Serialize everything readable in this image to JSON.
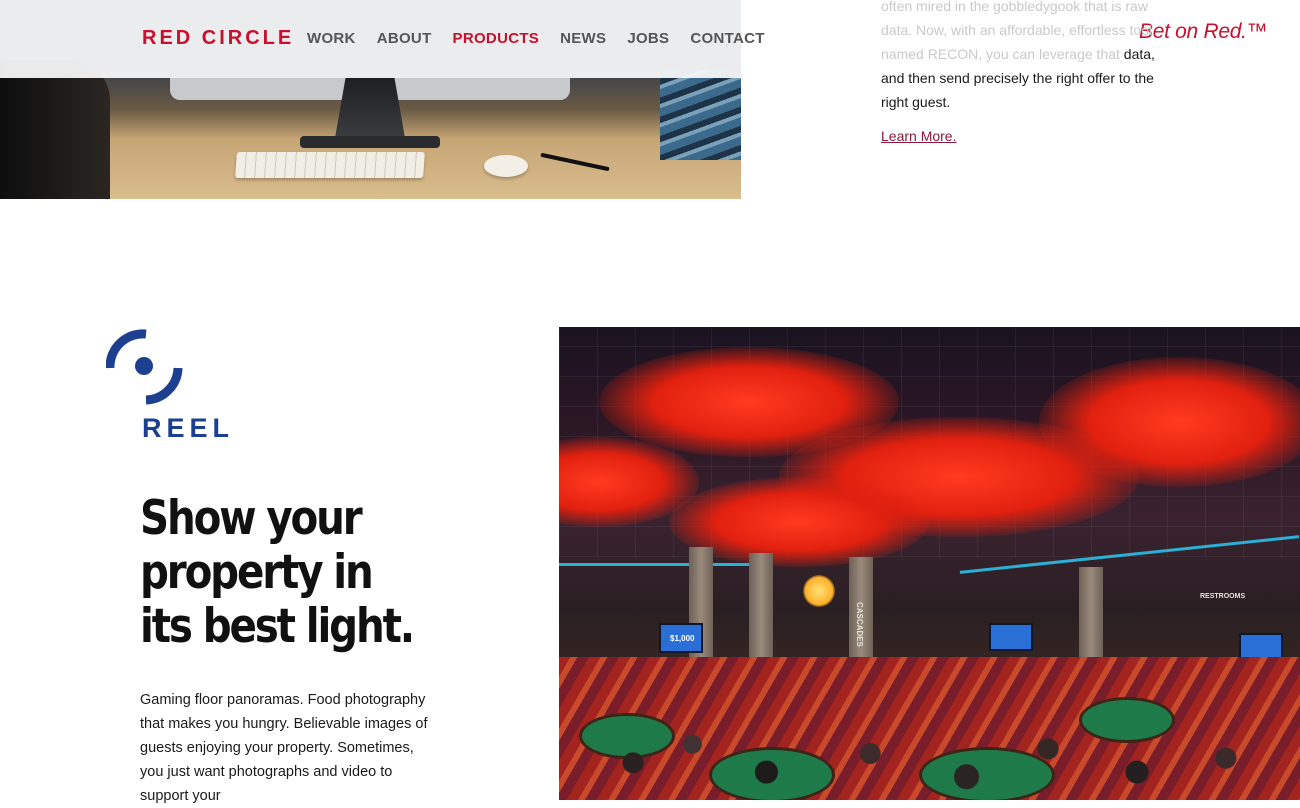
{
  "header": {
    "logo": "RED CIRCLE",
    "nav": [
      {
        "label": "WORK",
        "active": false
      },
      {
        "label": "ABOUT",
        "active": false
      },
      {
        "label": "PRODUCTS",
        "active": true
      },
      {
        "label": "NEWS",
        "active": false
      },
      {
        "label": "JOBS",
        "active": false
      },
      {
        "label": "CONTACT",
        "active": false
      }
    ],
    "tagline": "Bet on Red.™"
  },
  "recon": {
    "text_faded": "often mired in the gobbledygook that is raw data. Now, with an affordable, effortless tool named RECON, you can leverage that",
    "text_visible": "data, and then send precisely the right offer to the right guest.",
    "link": "Learn More."
  },
  "reel": {
    "wordmark": "REEL",
    "headline": "Show your property in its best light.",
    "body": "Gaming floor panoramas. Food photography that makes you hungry. Believable images of guests enjoying your property. Sometimes, you just want photographs and video to support your"
  },
  "casino_photo": {
    "signs": [
      "$1,000",
      "CASCADES",
      "RESTROOMS"
    ]
  },
  "colors": {
    "brand_red": "#c8102e",
    "reel_blue": "#1d3f8f",
    "link": "#8c1a3e"
  }
}
